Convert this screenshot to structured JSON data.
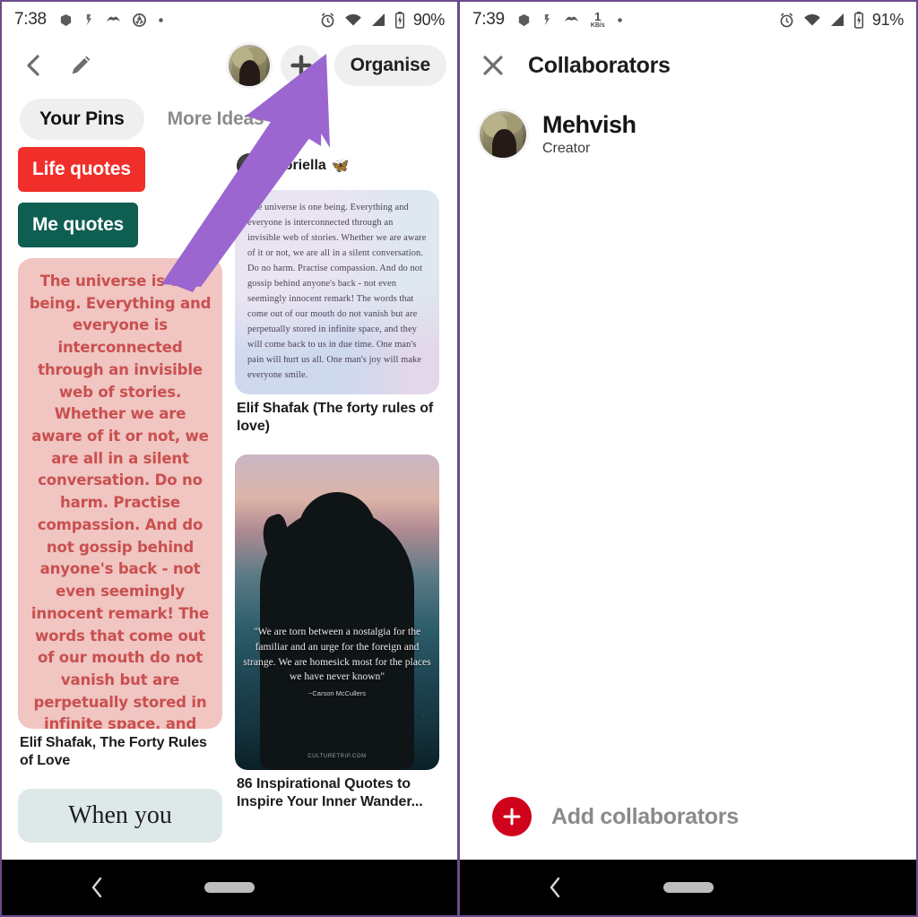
{
  "left": {
    "status": {
      "time": "7:38",
      "battery": "90%",
      "icons": [
        "app-icon",
        "app-icon",
        "app-icon",
        "app-icon",
        "dot-icon"
      ],
      "right_icons": [
        "alarm-icon",
        "wifi-icon",
        "signal-icon",
        "battery-icon"
      ]
    },
    "appbar": {
      "back": "back-arrow-icon",
      "edit": "pencil-icon",
      "avatar": "board-owner-avatar",
      "add": "plus-icon",
      "organise_label": "Organise"
    },
    "tabs": [
      {
        "label": "Your Pins",
        "active": true
      },
      {
        "label": "More Ideas",
        "active": false
      }
    ],
    "chips": [
      {
        "label": "Life quotes",
        "color": "#f02f2b"
      },
      {
        "label": "Me quotes",
        "color": "#0e5e51"
      }
    ],
    "pins": [
      {
        "id": "pin-pink-quote",
        "body": "The universe is one being. Everything and everyone is interconnected through an invisible web of stories. Whether we are aware of it or not, we are all in a silent conversation. Do no harm. Practise compassion. And do not gossip behind anyone's back - not even seemingly innocent remark! The words that come out of our mouth do not vanish but are perpetually stored in infinite space, and they will come back to us in due time. One man's pain will hurt us all. One man's joy will make everyone smile.",
        "caption": "Elif Shafak, The Forty Rules of Love"
      },
      {
        "id": "pin-blue-quote",
        "username": "gabriella",
        "username_emoji": "🦋",
        "body": "The universe is one being. Everything and everyone is interconnected through an invisible web of stories. Whether we are aware of it or not, we are all in a silent conversation. Do no harm. Practise compassion. And do not gossip behind anyone's back - not even seemingly innocent remark! The words that come out of our mouth do not vanish but are perpetually stored in infinite space, and they will come back to us in due time. One man's pain will hurt us all. One man's joy will make everyone smile.",
        "caption": "Elif Shafak (The forty rules of love)"
      },
      {
        "id": "pin-wanderlust-photo",
        "quote": "\"We are torn between a nostalgia for the familiar and an urge for the foreign and strange. We are homesick most for the places we have never known\"",
        "attribution": "~Carson McCullers",
        "watermark": "CULTURETRIP.COM",
        "caption": "86 Inspirational Quotes to Inspire Your Inner Wander..."
      },
      {
        "id": "pin-mint-quote",
        "body": "When you",
        "caption": ""
      }
    ]
  },
  "right": {
    "status": {
      "time": "7:39",
      "battery": "91%",
      "data_rate_value": "1",
      "data_rate_unit": "KB/s"
    },
    "header": {
      "close": "close-icon",
      "title": "Collaborators"
    },
    "collaborators": [
      {
        "name": "Mehvish",
        "role": "Creator"
      }
    ],
    "add_collaborators": {
      "label": "Add collaborators",
      "icon": "plus-circle-icon",
      "color": "#d0021b"
    }
  },
  "navbar": {
    "back": "nav-back-icon",
    "home": "nav-home-pill"
  },
  "annotation": {
    "arrow_color": "#9b66d0",
    "points_to": "add-collaborator-plus-button"
  }
}
